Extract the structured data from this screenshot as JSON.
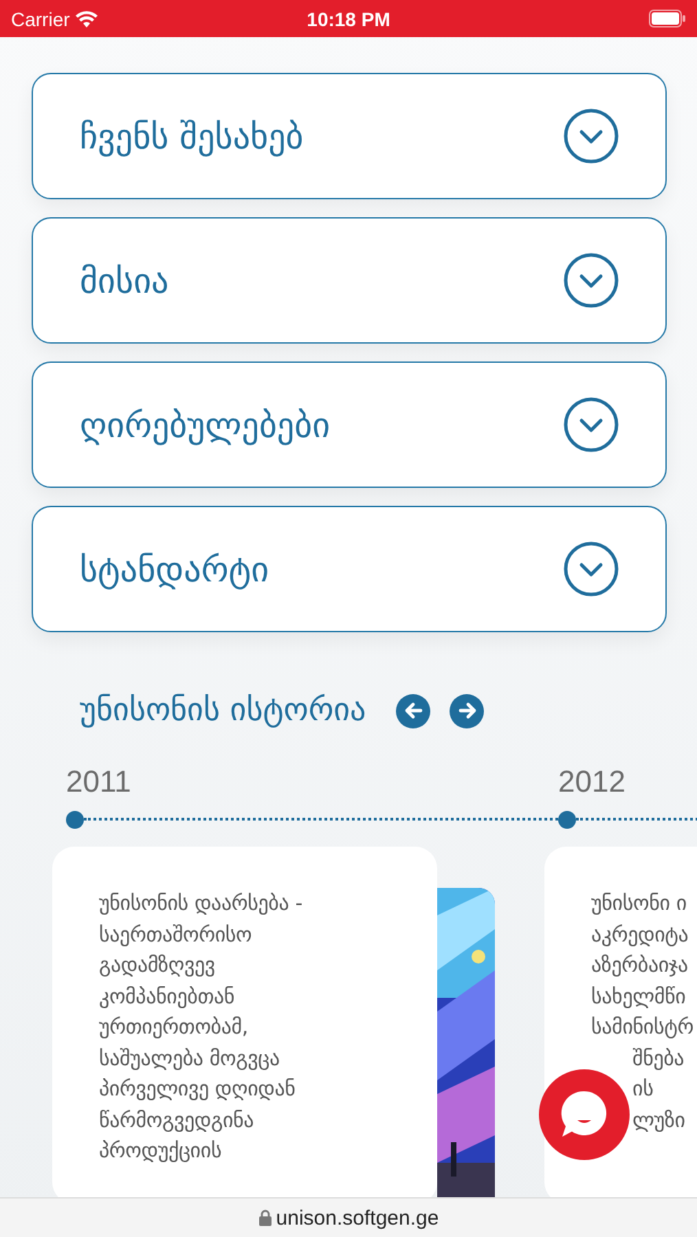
{
  "status_bar": {
    "carrier": "Carrier",
    "time": "10:18 PM"
  },
  "accordion": [
    {
      "title": "ჩვენს შესახებ",
      "expanded": false
    },
    {
      "title": "მისია",
      "expanded": false
    },
    {
      "title": "ღირებულებები",
      "expanded": false
    },
    {
      "title": "სტანდარტი",
      "expanded": false
    }
  ],
  "history": {
    "title": "უნისონის ისტორია",
    "years": [
      {
        "year": "2011",
        "lines": [
          "უნისონის დაარსება -",
          "საერთაშორისო",
          "გადამზღვევ",
          "კომპანიებთან",
          "ურთიერთობამ,",
          "საშუალება მოგვცა",
          "პირველივე დღიდან",
          "წარმოგვედგინა",
          "პროდუქციის"
        ]
      },
      {
        "year": "2012",
        "lines": [
          "უნისონი ი",
          "აკრედიტა",
          "აზერბაიჯა",
          "სახელმწი",
          "სამინისტრ"
        ],
        "covered_lines": [
          "შნება",
          "ის",
          "ლუზი"
        ]
      }
    ]
  },
  "url_bar": {
    "address": "unison.softgen.ge"
  }
}
